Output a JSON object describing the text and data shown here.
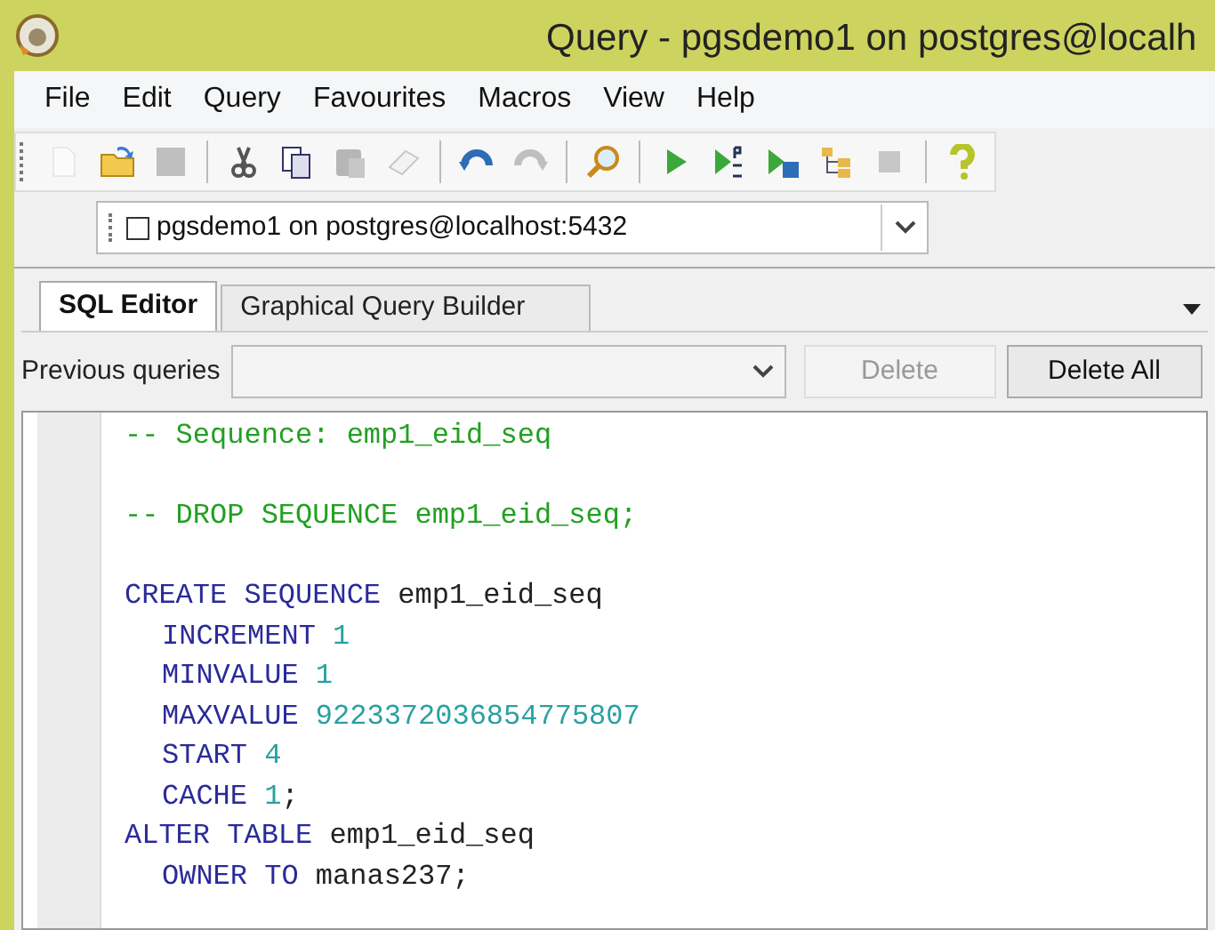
{
  "window": {
    "title": "Query - pgsdemo1 on postgres@localh"
  },
  "menu": [
    {
      "label": "File"
    },
    {
      "label": "Edit"
    },
    {
      "label": "Query"
    },
    {
      "label": "Favourites"
    },
    {
      "label": "Macros"
    },
    {
      "label": "View"
    },
    {
      "label": "Help"
    }
  ],
  "toolbar": [
    {
      "kind": "new",
      "disabled": true
    },
    {
      "kind": "open",
      "disabled": false
    },
    {
      "kind": "save",
      "disabled": true
    },
    {
      "kind": "sep"
    },
    {
      "kind": "cut",
      "disabled": false
    },
    {
      "kind": "copy",
      "disabled": false
    },
    {
      "kind": "paste",
      "disabled": true
    },
    {
      "kind": "eraser",
      "disabled": true
    },
    {
      "kind": "sep"
    },
    {
      "kind": "undo",
      "disabled": false
    },
    {
      "kind": "redo",
      "disabled": true
    },
    {
      "kind": "sep"
    },
    {
      "kind": "find",
      "disabled": false
    },
    {
      "kind": "sep"
    },
    {
      "kind": "run",
      "disabled": false
    },
    {
      "kind": "runpgs",
      "disabled": false
    },
    {
      "kind": "runsave",
      "disabled": false
    },
    {
      "kind": "explain",
      "disabled": false
    },
    {
      "kind": "stop",
      "disabled": true
    },
    {
      "kind": "sep"
    },
    {
      "kind": "help",
      "disabled": false
    }
  ],
  "connection": {
    "value": "pgsdemo1 on postgres@localhost:5432",
    "checked": false
  },
  "tabs": [
    {
      "label": "SQL Editor",
      "selected": true
    },
    {
      "label": "Graphical Query Builder",
      "selected": false
    }
  ],
  "previous_queries": {
    "label": "Previous queries"
  },
  "buttons": [
    {
      "label": "Delete",
      "disabled": true
    },
    {
      "label": "Delete All",
      "disabled": false
    }
  ],
  "editor": {
    "lines": [
      {
        "kind": "code",
        "indent": false,
        "tokens": [
          {
            "kind": "comment",
            "text": "-- Sequence: emp1_eid_seq"
          }
        ]
      },
      {
        "kind": "blank"
      },
      {
        "kind": "code",
        "indent": false,
        "tokens": [
          {
            "kind": "comment",
            "text": "-- DROP SEQUENCE emp1_eid_seq;"
          }
        ]
      },
      {
        "kind": "blank"
      },
      {
        "kind": "code",
        "indent": false,
        "tokens": [
          {
            "kind": "keyword",
            "text": "CREATE SEQUENCE"
          },
          {
            "kind": "plain",
            "text": " emp1_eid_seq"
          }
        ]
      },
      {
        "kind": "code",
        "indent": true,
        "tokens": [
          {
            "kind": "keyword",
            "text": "INCREMENT"
          },
          {
            "kind": "number",
            "text": " 1"
          }
        ]
      },
      {
        "kind": "code",
        "indent": true,
        "tokens": [
          {
            "kind": "keyword",
            "text": "MINVALUE"
          },
          {
            "kind": "number",
            "text": " 1"
          }
        ]
      },
      {
        "kind": "code",
        "indent": true,
        "tokens": [
          {
            "kind": "keyword",
            "text": "MAXVALUE"
          },
          {
            "kind": "number",
            "text": " 9223372036854775807"
          }
        ]
      },
      {
        "kind": "code",
        "indent": true,
        "tokens": [
          {
            "kind": "keyword",
            "text": "START"
          },
          {
            "kind": "number",
            "text": " 4"
          }
        ]
      },
      {
        "kind": "code",
        "indent": true,
        "tokens": [
          {
            "kind": "keyword",
            "text": "CACHE"
          },
          {
            "kind": "number",
            "text": " 1"
          },
          {
            "kind": "plain",
            "text": ";"
          }
        ]
      },
      {
        "kind": "code",
        "indent": false,
        "tokens": [
          {
            "kind": "keyword",
            "text": "ALTER TABLE"
          },
          {
            "kind": "plain",
            "text": " emp1_eid_seq"
          }
        ]
      },
      {
        "kind": "code",
        "indent": true,
        "tokens": [
          {
            "kind": "keyword",
            "text": "OWNER TO"
          },
          {
            "kind": "plain",
            "text": " manas237;"
          }
        ]
      }
    ]
  }
}
